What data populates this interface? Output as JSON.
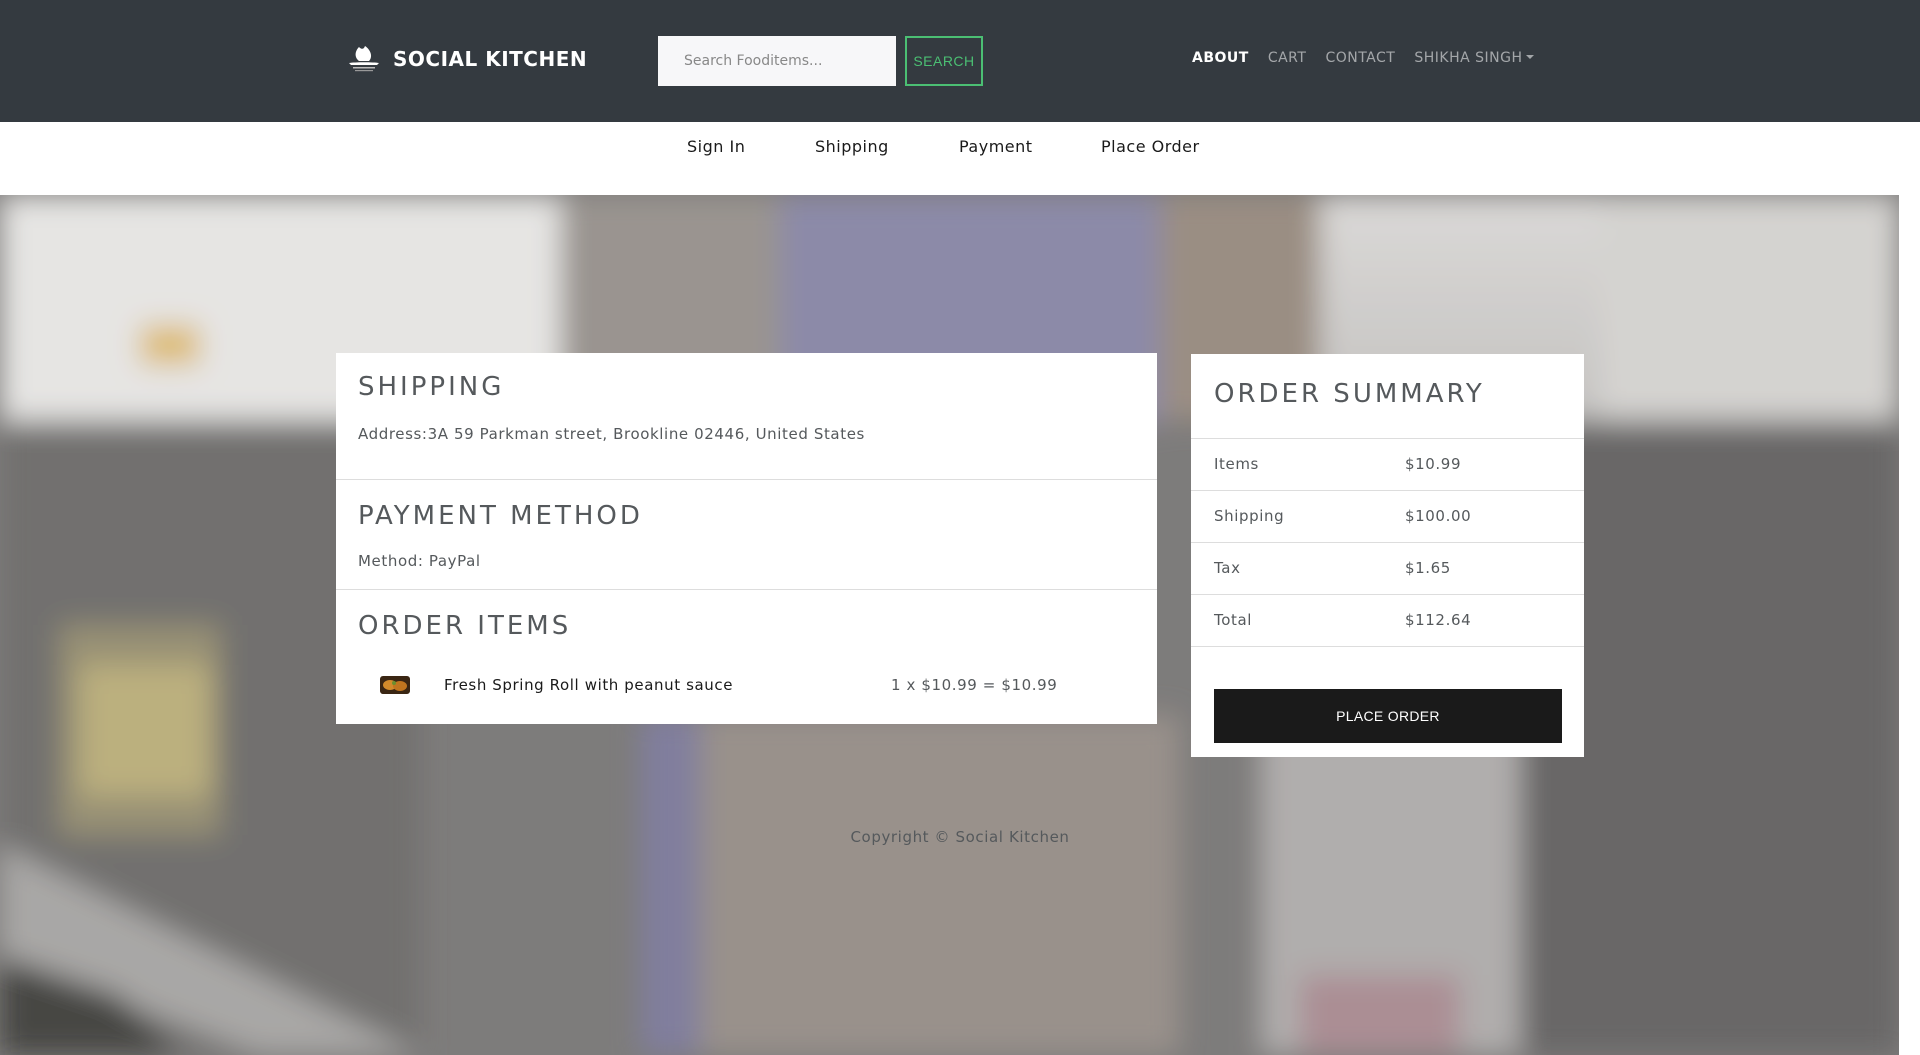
{
  "navbar": {
    "brand": "SOCIAL KITCHEN",
    "search_placeholder": "Search Fooditems...",
    "search_button": "SEARCH",
    "links": [
      "ABOUT",
      "CART",
      "CONTACT"
    ],
    "user_menu": "SHIKHA SINGH"
  },
  "steps": [
    "Sign In",
    "Shipping",
    "Payment",
    "Place Order"
  ],
  "shipping": {
    "heading": "SHIPPING",
    "address": "Address:3A 59 Parkman street, Brookline 02446, United States"
  },
  "payment": {
    "heading": "PAYMENT METHOD",
    "method": "Method: PayPal"
  },
  "order_items": {
    "heading": "ORDER ITEMS",
    "items": [
      {
        "name": "Fresh Spring Roll with peanut sauce",
        "price_line": "1 x $10.99 = $10.99"
      }
    ]
  },
  "summary": {
    "heading": "ORDER SUMMARY",
    "rows": [
      {
        "label": "Items",
        "value": "$10.99"
      },
      {
        "label": "Shipping",
        "value": "$100.00"
      },
      {
        "label": "Tax",
        "value": "$1.65"
      },
      {
        "label": "Total",
        "value": "$112.64"
      }
    ],
    "button": "PLACE ORDER"
  },
  "footer": "Copyright © Social Kitchen"
}
